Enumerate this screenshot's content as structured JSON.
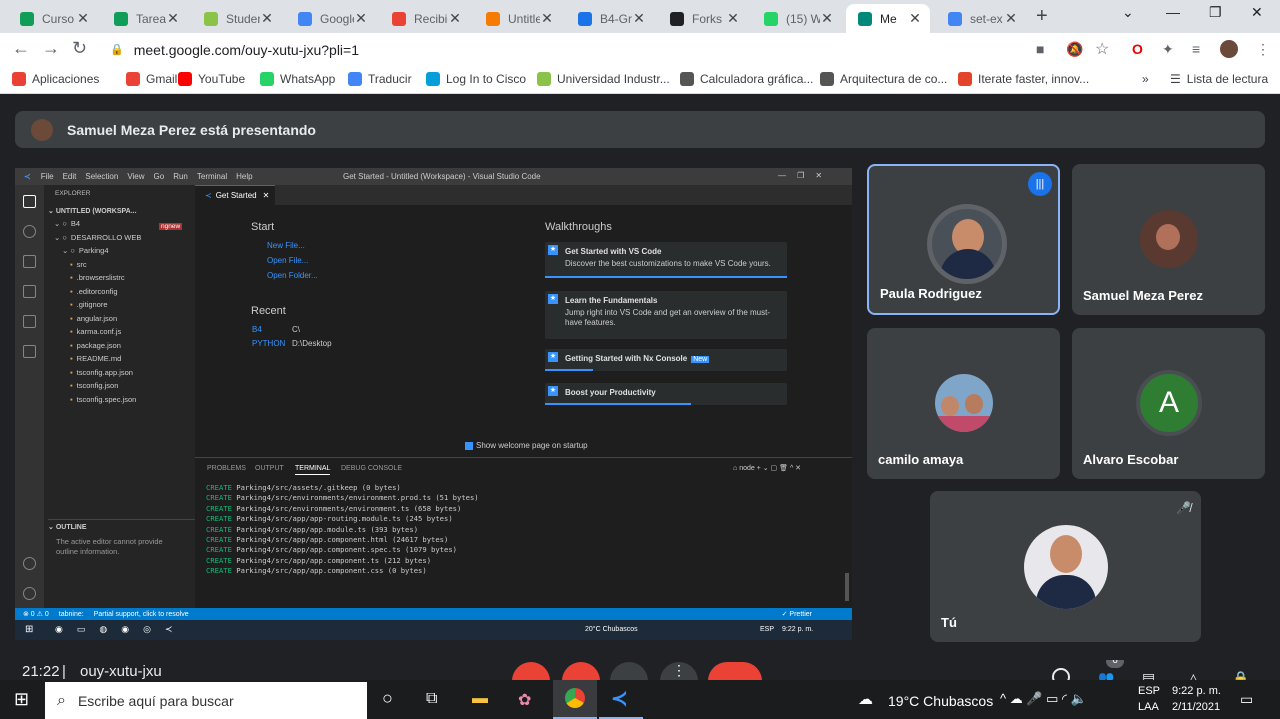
{
  "tabs": [
    {
      "label": "Curso",
      "color": "#0f9d58"
    },
    {
      "label": "Tarea",
      "color": "#0f9d58"
    },
    {
      "label": "Studen",
      "color": "#8bc34a"
    },
    {
      "label": "Google",
      "color": "#4285f4"
    },
    {
      "label": "Recibid",
      "color": "#ea4335"
    },
    {
      "label": "Untitle",
      "color": "#f57c00"
    },
    {
      "label": "B4-Gra",
      "color": "#1a73e8"
    },
    {
      "label": "Forks",
      "color": "#202124"
    },
    {
      "label": "(15) W",
      "color": "#25d366"
    },
    {
      "label": "Me",
      "color": "#00897b"
    },
    {
      "label": "set-ex",
      "color": "#4285f4"
    }
  ],
  "address": {
    "url": "meet.google.com/ouy-xutu-jxu?pli=1"
  },
  "bookmarks": [
    {
      "label": "Aplicaciones",
      "color": "#e94235"
    },
    {
      "label": "Gmail",
      "color": "#ea4335"
    },
    {
      "label": "YouTube",
      "color": "#ff0000"
    },
    {
      "label": "WhatsApp",
      "color": "#25d366"
    },
    {
      "label": "Traducir",
      "color": "#4285f4"
    },
    {
      "label": "Log In to Cisco",
      "color": "#049fd9"
    },
    {
      "label": "Universidad Industr...",
      "color": "#8bc34a"
    },
    {
      "label": "Calculadora gráfica...",
      "color": "#555555"
    },
    {
      "label": "Arquitectura de co...",
      "color": "#555555"
    },
    {
      "label": "Iterate faster, innov...",
      "color": "#e24329"
    }
  ],
  "reading_list": "Lista de lectura",
  "banner": {
    "text": "Samuel Meza Perez está presentando"
  },
  "vscode": {
    "menu": [
      "File",
      "Edit",
      "Selection",
      "View",
      "Go",
      "Run",
      "Terminal",
      "Help"
    ],
    "window_title": "Get Started - Untitled (Workspace) - Visual Studio Code",
    "explorer_label": "EXPLORER",
    "workspace_label": "UNTITLED (WORKSPA...",
    "tree": [
      {
        "label": "B4",
        "indent": 0
      },
      {
        "label": "DESARROLLO WEB",
        "indent": 0
      },
      {
        "label": "Parking4",
        "indent": 1
      },
      {
        "label": "src",
        "indent": 2
      },
      {
        "label": ".browserslistrc",
        "indent": 2
      },
      {
        "label": ".editorconfig",
        "indent": 2
      },
      {
        "label": ".gitignore",
        "indent": 2
      },
      {
        "label": "angular.json",
        "indent": 2
      },
      {
        "label": "karma.conf.js",
        "indent": 2
      },
      {
        "label": "package.json",
        "indent": 2
      },
      {
        "label": "README.md",
        "indent": 2
      },
      {
        "label": "tsconfig.app.json",
        "indent": 2
      },
      {
        "label": "tsconfig.json",
        "indent": 2
      },
      {
        "label": "tsconfig.spec.json",
        "indent": 2
      }
    ],
    "badge": "ngnew",
    "outline_label": "OUTLINE",
    "outline_text": "The active editor cannot provide outline information.",
    "tab_label": "Get Started",
    "start_heading": "Start",
    "start_links": [
      "New File...",
      "Open File...",
      "Open Folder..."
    ],
    "recent_heading": "Recent",
    "recent": [
      {
        "name": "B4",
        "path": "C\\"
      },
      {
        "name": "PYTHON",
        "path": "D:\\Desktop"
      }
    ],
    "walk_heading": "Walkthroughs",
    "walk_cards": [
      {
        "title": "Get Started with VS Code",
        "desc": "Discover the best customizations to make VS Code yours."
      },
      {
        "title": "Learn the Fundamentals",
        "desc": "Jump right into VS Code and get an overview of the must-have features."
      },
      {
        "title": "Getting Started with Nx Console",
        "desc": "",
        "badge": "New"
      },
      {
        "title": "Boost your Productivity",
        "desc": ""
      }
    ],
    "startup_checkbox": "Show welcome page on startup",
    "panel_tabs": [
      "PROBLEMS",
      "OUTPUT",
      "TERMINAL",
      "DEBUG CONSOLE"
    ],
    "panel_node": "node",
    "terminal": [
      "Parking4/src/assets/.gitkeep (0 bytes)",
      "Parking4/src/environments/environment.prod.ts (51 bytes)",
      "Parking4/src/environments/environment.ts (658 bytes)",
      "Parking4/src/app/app-routing.module.ts (245 bytes)",
      "Parking4/src/app/app.module.ts (393 bytes)",
      "Parking4/src/app/app.component.html (24617 bytes)",
      "Parking4/src/app/app.component.spec.ts (1079 bytes)",
      "Parking4/src/app/app.component.ts (212 bytes)",
      "Parking4/src/app/app.component.css (0 bytes)"
    ],
    "terminal_prefix": "CREATE",
    "status_left": "⊗ 0 ⚠ 0",
    "status_tabnine": "tabnine:",
    "status_partial": "Partial support, click to resolve",
    "status_prettier": "✓ Prettier",
    "task_weather": "20°C Chubascos",
    "task_lang": "ESP",
    "task_time": "9:22 p. m."
  },
  "participants": [
    {
      "name": "Paula Rodriguez"
    },
    {
      "name": "Samuel Meza Perez"
    },
    {
      "name": "camilo amaya"
    },
    {
      "name": "Alvaro Escobar",
      "initial": "A"
    },
    {
      "name": "Tú"
    }
  ],
  "footer": {
    "time": "21:22",
    "code": "ouy-xutu-jxu",
    "people_count": "6"
  },
  "taskbar": {
    "search_placeholder": "Escribe aquí para buscar",
    "weather": "19°C  Chubascos",
    "lang1": "ESP",
    "lang2": "LAA",
    "time": "9:22 p. m.",
    "date": "2/11/2021"
  }
}
